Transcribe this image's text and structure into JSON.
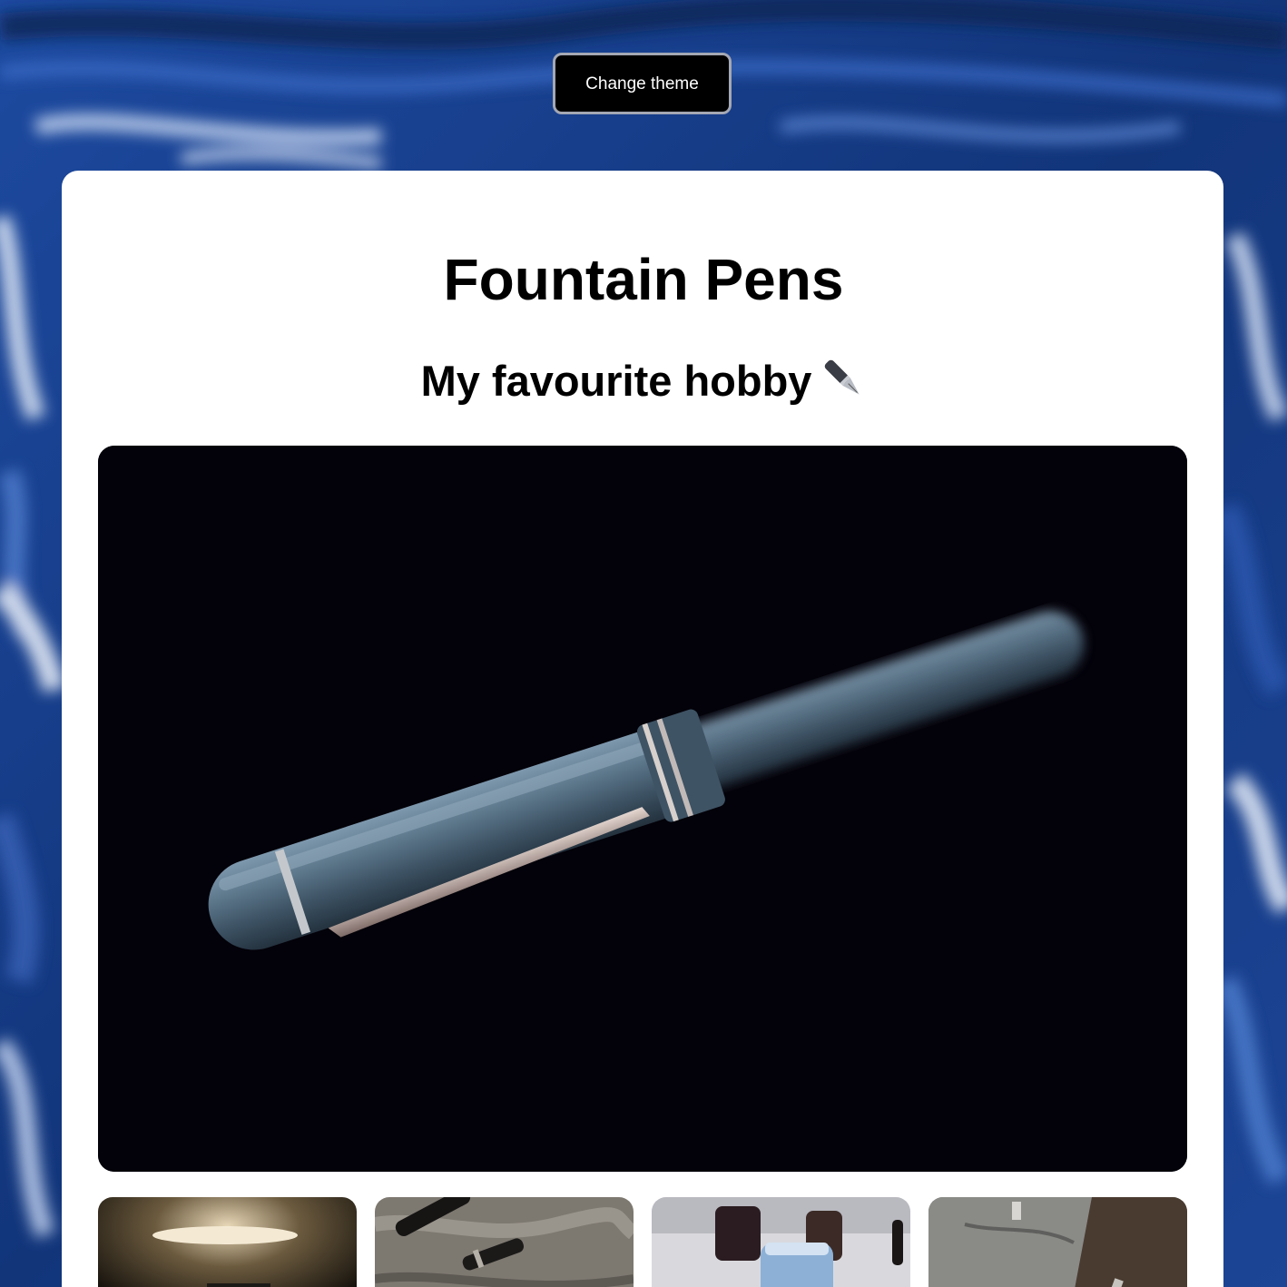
{
  "header": {
    "theme_button_label": "Change theme"
  },
  "main": {
    "title": "Fountain Pens",
    "subtitle": "My favourite hobby",
    "subtitle_icon": "fountain-pen-icon"
  },
  "colors": {
    "background": "#163a82",
    "card": "#ffffff",
    "button": "#000000",
    "button_border": "#a4a8b4"
  }
}
